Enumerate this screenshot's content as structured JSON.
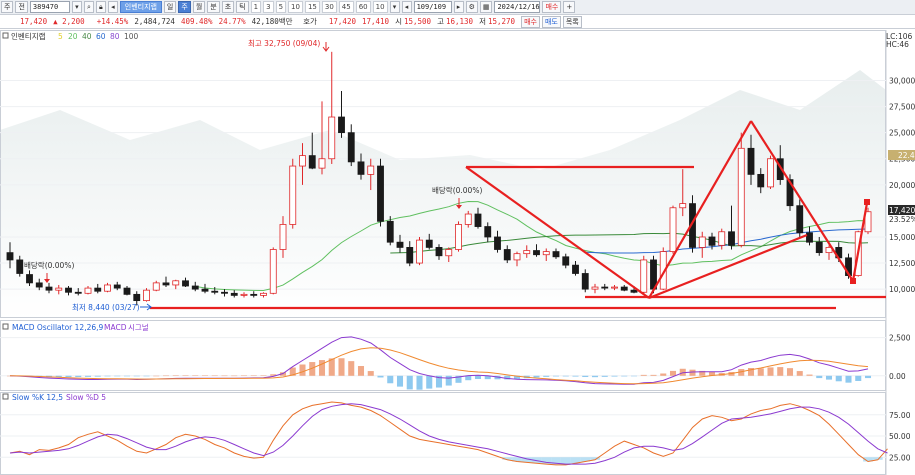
{
  "toolbar": {
    "mode_label": "주",
    "type_label": "전",
    "stock_code": "389470",
    "search_icon": "search-icon",
    "indicator_label": "인벤티지랩",
    "period_buttons": [
      "일",
      "주",
      "월",
      "분",
      "초",
      "틱"
    ],
    "active_period": "주",
    "interval_buttons": [
      "1",
      "3",
      "5",
      "10",
      "15",
      "30",
      "45",
      "60",
      "10"
    ],
    "count_value": "109/109",
    "date_value": "2024/12/16",
    "buy_label": "매수",
    "sell_label": "매도",
    "list_label": "목록"
  },
  "quote": {
    "price": "17,420",
    "change": "2,200",
    "change_pct": "+14.45%",
    "volume": "2,484,724",
    "volume_pct": "409.48%",
    "turnover_pct": "24.77%",
    "amount": "42,180백만",
    "ask_label": "호가",
    "ask": "17,420",
    "bid": "17,410",
    "open_label": "시",
    "open": "15,500",
    "high_label": "고",
    "high": "16,130",
    "low_label": "저",
    "low": "15,270"
  },
  "main_panel": {
    "legend_title": "인벤티지랩",
    "legend_ma": [
      "5",
      "20",
      "40",
      "60",
      "80",
      "100"
    ],
    "right_top_labels": [
      "LC:106",
      "HC:46"
    ],
    "annotation_high": "최고 32,750 (09/04)",
    "annotation_low": "최저 8,440 (03/27)",
    "annotation_dividend_1": "배당락(0.00%)",
    "annotation_dividend_2": "배당락(0.00%)",
    "current_price_label": "17,420",
    "current_pct_label": "23.52%",
    "ref_price_label": "22.41",
    "y_ticks": [
      "30,000",
      "27,500",
      "25,000",
      "22,500",
      "20,000",
      "15,000",
      "12,500",
      "10,000"
    ]
  },
  "macd_panel": {
    "legend_title": "MACD Oscillator 12,26,9",
    "legend_macd": "MACD",
    "legend_signal": "시그널",
    "y_ticks": [
      "2,500",
      "0.00"
    ]
  },
  "stoch_panel": {
    "legend_title": "Slow %K 12,5",
    "legend_d": "Slow %D 5",
    "y_ticks": [
      "75.00",
      "50.00",
      "25.00"
    ]
  },
  "colors": {
    "up": "#e0282a",
    "down": "#1a1a1a",
    "trend": "#e82020",
    "macd_line": "#8b3ad0",
    "signal_line": "#f08a30",
    "osc_pos": "#f0a988",
    "osc_neg": "#8ec9ef",
    "stoch_k": "#e8702a",
    "stoch_d": "#8b3ad0"
  },
  "chart_data": {
    "type": "candlestick",
    "y_range": [
      8000,
      33500
    ],
    "candles": [
      {
        "o": 13500,
        "h": 14500,
        "l": 12000,
        "c": 12800
      },
      {
        "o": 12800,
        "h": 13200,
        "l": 11200,
        "c": 11500
      },
      {
        "o": 11400,
        "h": 11800,
        "l": 10300,
        "c": 10600
      },
      {
        "o": 10600,
        "h": 11000,
        "l": 9900,
        "c": 10200
      },
      {
        "o": 10200,
        "h": 10600,
        "l": 9600,
        "c": 9900
      },
      {
        "o": 9900,
        "h": 10400,
        "l": 9500,
        "c": 10100
      },
      {
        "o": 10100,
        "h": 10300,
        "l": 9400,
        "c": 9700
      },
      {
        "o": 9700,
        "h": 10100,
        "l": 9400,
        "c": 9600
      },
      {
        "o": 9600,
        "h": 10300,
        "l": 9500,
        "c": 10100
      },
      {
        "o": 10100,
        "h": 10500,
        "l": 9600,
        "c": 9800
      },
      {
        "o": 9800,
        "h": 10600,
        "l": 9700,
        "c": 10400
      },
      {
        "o": 10400,
        "h": 10700,
        "l": 9900,
        "c": 10100
      },
      {
        "o": 10100,
        "h": 10300,
        "l": 9400,
        "c": 9500
      },
      {
        "o": 9500,
        "h": 9800,
        "l": 8440,
        "c": 8900
      },
      {
        "o": 8900,
        "h": 10100,
        "l": 8800,
        "c": 9900
      },
      {
        "o": 9900,
        "h": 10800,
        "l": 9800,
        "c": 10600
      },
      {
        "o": 10600,
        "h": 11200,
        "l": 10200,
        "c": 10400
      },
      {
        "o": 10400,
        "h": 10900,
        "l": 10000,
        "c": 10800
      },
      {
        "o": 10800,
        "h": 11100,
        "l": 10200,
        "c": 10300
      },
      {
        "o": 10300,
        "h": 10700,
        "l": 9800,
        "c": 10000
      },
      {
        "o": 10000,
        "h": 10500,
        "l": 9600,
        "c": 9800
      },
      {
        "o": 9800,
        "h": 10200,
        "l": 9500,
        "c": 9700
      },
      {
        "o": 9700,
        "h": 10000,
        "l": 9300,
        "c": 9600
      },
      {
        "o": 9600,
        "h": 9900,
        "l": 9200,
        "c": 9400
      },
      {
        "o": 9400,
        "h": 9700,
        "l": 9200,
        "c": 9500
      },
      {
        "o": 9500,
        "h": 9800,
        "l": 9200,
        "c": 9400
      },
      {
        "o": 9400,
        "h": 9700,
        "l": 9200,
        "c": 9600
      },
      {
        "o": 9600,
        "h": 14000,
        "l": 9500,
        "c": 13800
      },
      {
        "o": 13800,
        "h": 17000,
        "l": 13000,
        "c": 16200
      },
      {
        "o": 16200,
        "h": 22500,
        "l": 15800,
        "c": 21800
      },
      {
        "o": 21800,
        "h": 24000,
        "l": 20000,
        "c": 22800
      },
      {
        "o": 22800,
        "h": 25000,
        "l": 21500,
        "c": 21600
      },
      {
        "o": 21600,
        "h": 28000,
        "l": 21000,
        "c": 22500
      },
      {
        "o": 22500,
        "h": 32750,
        "l": 22000,
        "c": 26500
      },
      {
        "o": 26500,
        "h": 29000,
        "l": 24500,
        "c": 25000
      },
      {
        "o": 25000,
        "h": 25800,
        "l": 21800,
        "c": 22200
      },
      {
        "o": 22200,
        "h": 23000,
        "l": 20500,
        "c": 21000
      },
      {
        "o": 21000,
        "h": 22500,
        "l": 19500,
        "c": 21800
      },
      {
        "o": 21800,
        "h": 22500,
        "l": 16000,
        "c": 16500
      },
      {
        "o": 16500,
        "h": 17000,
        "l": 14200,
        "c": 14500
      },
      {
        "o": 14500,
        "h": 15200,
        "l": 13500,
        "c": 14000
      },
      {
        "o": 14000,
        "h": 14600,
        "l": 12200,
        "c": 12500
      },
      {
        "o": 12500,
        "h": 15000,
        "l": 12300,
        "c": 14700
      },
      {
        "o": 14700,
        "h": 15300,
        "l": 13800,
        "c": 14000
      },
      {
        "o": 14000,
        "h": 14300,
        "l": 12800,
        "c": 13200
      },
      {
        "o": 13200,
        "h": 14000,
        "l": 12600,
        "c": 13800
      },
      {
        "o": 13800,
        "h": 16500,
        "l": 13600,
        "c": 16200
      },
      {
        "o": 16200,
        "h": 17500,
        "l": 15900,
        "c": 17200
      },
      {
        "o": 17200,
        "h": 17800,
        "l": 15800,
        "c": 16000
      },
      {
        "o": 16000,
        "h": 16400,
        "l": 14500,
        "c": 15000
      },
      {
        "o": 15000,
        "h": 15600,
        "l": 13500,
        "c": 13800
      },
      {
        "o": 13800,
        "h": 14200,
        "l": 12500,
        "c": 12800
      },
      {
        "o": 12800,
        "h": 13600,
        "l": 12200,
        "c": 13400
      },
      {
        "o": 13400,
        "h": 14200,
        "l": 13000,
        "c": 13700
      },
      {
        "o": 13700,
        "h": 14300,
        "l": 13100,
        "c": 13300
      },
      {
        "o": 13300,
        "h": 13900,
        "l": 12700,
        "c": 13600
      },
      {
        "o": 13600,
        "h": 13900,
        "l": 12900,
        "c": 13100
      },
      {
        "o": 13100,
        "h": 13400,
        "l": 12000,
        "c": 12300
      },
      {
        "o": 12300,
        "h": 12700,
        "l": 11300,
        "c": 11500
      },
      {
        "o": 11500,
        "h": 11900,
        "l": 9700,
        "c": 10000
      },
      {
        "o": 10000,
        "h": 10500,
        "l": 9600,
        "c": 10200
      },
      {
        "o": 10200,
        "h": 10500,
        "l": 9900,
        "c": 10100
      },
      {
        "o": 10100,
        "h": 10400,
        "l": 9900,
        "c": 10200
      },
      {
        "o": 10200,
        "h": 10400,
        "l": 9800,
        "c": 9900
      },
      {
        "o": 9900,
        "h": 10300,
        "l": 9600,
        "c": 9700
      },
      {
        "o": 9700,
        "h": 13200,
        "l": 9500,
        "c": 12800
      },
      {
        "o": 12800,
        "h": 13200,
        "l": 9600,
        "c": 10000
      },
      {
        "o": 10000,
        "h": 14000,
        "l": 9900,
        "c": 13600
      },
      {
        "o": 13600,
        "h": 18000,
        "l": 13400,
        "c": 17800
      },
      {
        "o": 17800,
        "h": 21500,
        "l": 17000,
        "c": 18200
      },
      {
        "o": 18200,
        "h": 19000,
        "l": 13500,
        "c": 14000
      },
      {
        "o": 14000,
        "h": 15500,
        "l": 13000,
        "c": 15000
      },
      {
        "o": 15000,
        "h": 15400,
        "l": 13800,
        "c": 14200
      },
      {
        "o": 14200,
        "h": 15800,
        "l": 13800,
        "c": 15500
      },
      {
        "o": 15500,
        "h": 18000,
        "l": 13800,
        "c": 14200
      },
      {
        "o": 14200,
        "h": 25000,
        "l": 14000,
        "c": 23500
      },
      {
        "o": 23500,
        "h": 24800,
        "l": 20000,
        "c": 21000
      },
      {
        "o": 21000,
        "h": 21600,
        "l": 19200,
        "c": 19800
      },
      {
        "o": 19800,
        "h": 22800,
        "l": 19600,
        "c": 22500
      },
      {
        "o": 22500,
        "h": 23800,
        "l": 20000,
        "c": 20500
      },
      {
        "o": 20500,
        "h": 21000,
        "l": 17500,
        "c": 18000
      },
      {
        "o": 18000,
        "h": 18600,
        "l": 15000,
        "c": 15400
      },
      {
        "o": 15400,
        "h": 16000,
        "l": 14200,
        "c": 14500
      },
      {
        "o": 14500,
        "h": 15000,
        "l": 13200,
        "c": 13500
      },
      {
        "o": 13500,
        "h": 14200,
        "l": 12800,
        "c": 14000
      },
      {
        "o": 14000,
        "h": 14500,
        "l": 12600,
        "c": 13000
      },
      {
        "o": 13000,
        "h": 13400,
        "l": 11000,
        "c": 11300
      },
      {
        "o": 11300,
        "h": 15600,
        "l": 11200,
        "c": 15500
      },
      {
        "o": 15500,
        "h": 17800,
        "l": 15270,
        "c": 17420
      }
    ],
    "macd": [
      0,
      -20,
      -60,
      -110,
      -150,
      -180,
      -210,
      -230,
      -240,
      -240,
      -230,
      -220,
      -220,
      -240,
      -230,
      -210,
      -190,
      -170,
      -160,
      -160,
      -160,
      -160,
      -160,
      -160,
      -150,
      -140,
      -130,
      -40,
      150,
      600,
      1000,
      1400,
      1800,
      2200,
      2500,
      2550,
      2400,
      2150,
      1700,
      1200,
      800,
      400,
      150,
      0,
      -120,
      -150,
      -80,
      10,
      40,
      0,
      -80,
      -180,
      -230,
      -250,
      -260,
      -270,
      -290,
      -330,
      -380,
      -460,
      -510,
      -530,
      -540,
      -550,
      -550,
      -450,
      -430,
      -300,
      -50,
      200,
      250,
      260,
      270,
      260,
      400,
      700,
      900,
      1000,
      1200,
      1350,
      1400,
      1300,
      1100,
      850,
      700,
      500,
      300,
      320,
      450
    ],
    "signal": [
      0,
      -5,
      -20,
      -45,
      -70,
      -100,
      -125,
      -150,
      -170,
      -185,
      -195,
      -200,
      -205,
      -210,
      -215,
      -212,
      -205,
      -198,
      -190,
      -185,
      -180,
      -177,
      -174,
      -171,
      -168,
      -164,
      -160,
      -140,
      -80,
      60,
      260,
      500,
      770,
      1060,
      1350,
      1590,
      1760,
      1840,
      1810,
      1690,
      1510,
      1290,
      1060,
      840,
      650,
      490,
      380,
      300,
      250,
      220,
      150,
      60,
      -20,
      -90,
      -150,
      -200,
      -250,
      -290,
      -330,
      -380,
      -420,
      -460,
      -490,
      -510,
      -520,
      -510,
      -490,
      -450,
      -370,
      -260,
      -150,
      -60,
      20,
      80,
      150,
      260,
      390,
      510,
      650,
      780,
      900,
      990,
      1020,
      1000,
      950,
      860,
      750,
      660,
      600
    ],
    "stoch_k": [
      30,
      32,
      28,
      34,
      33,
      36,
      40,
      48,
      52,
      55,
      50,
      45,
      38,
      32,
      30,
      35,
      40,
      48,
      52,
      50,
      46,
      40,
      36,
      30,
      26,
      24,
      25,
      45,
      62,
      75,
      82,
      86,
      88,
      90,
      89,
      86,
      84,
      80,
      74,
      66,
      58,
      50,
      46,
      44,
      42,
      40,
      38,
      36,
      34,
      30,
      26,
      22,
      20,
      19,
      18,
      17,
      16,
      16,
      18,
      20,
      22,
      30,
      38,
      44,
      40,
      36,
      30,
      26,
      30,
      45,
      60,
      70,
      74,
      72,
      68,
      70,
      76,
      80,
      82,
      86,
      88,
      85,
      80,
      74,
      64,
      52,
      40,
      28,
      20,
      22,
      35
    ],
    "stoch_d": [
      30,
      31,
      30,
      31,
      32,
      33,
      35,
      39,
      44,
      49,
      52,
      51,
      47,
      42,
      37,
      34,
      34,
      38,
      43,
      47,
      49,
      48,
      45,
      40,
      35,
      30,
      27,
      31,
      39,
      50,
      62,
      73,
      81,
      85,
      87,
      88,
      87,
      84,
      81,
      76,
      70,
      63,
      56,
      50,
      46,
      43,
      41,
      39,
      37,
      35,
      32,
      29,
      26,
      23,
      21,
      19,
      18,
      17,
      17,
      17,
      18,
      21,
      25,
      31,
      36,
      38,
      38,
      36,
      33,
      35,
      41,
      49,
      57,
      65,
      70,
      71,
      72,
      74,
      76,
      79,
      82,
      84,
      84,
      82,
      78,
      72,
      64,
      54,
      44,
      35,
      30
    ]
  }
}
